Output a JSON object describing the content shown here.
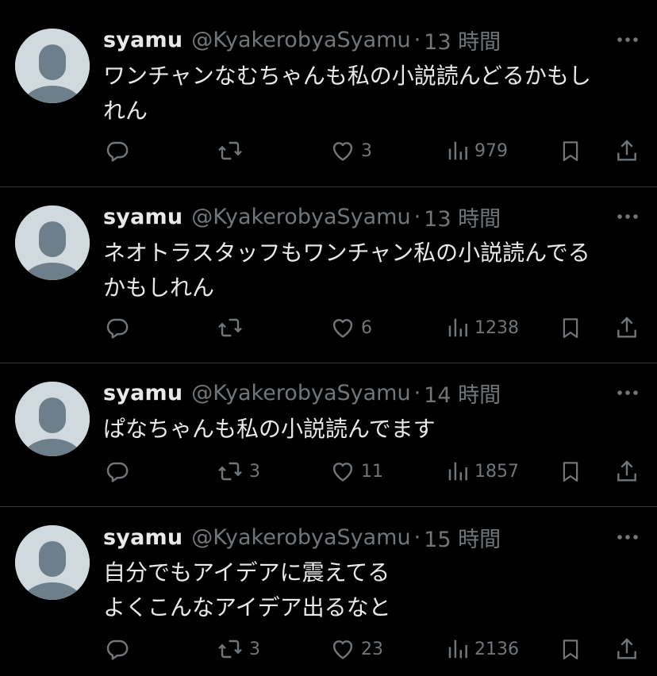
{
  "tweets": [
    {
      "name": "syamu",
      "handle": "@KyakerobyaSyamu",
      "separator": "·",
      "time": "13 時間",
      "text": "ワンチャンなむちゃんも私の小説読んどるかもし\nれん",
      "retweets": "",
      "likes": "3",
      "views": "979"
    },
    {
      "name": "syamu",
      "handle": "@KyakerobyaSyamu",
      "separator": "·",
      "time": "13 時間",
      "text": "ネオトラスタッフもワンチャン私の小説読んでる\nかもしれん",
      "retweets": "",
      "likes": "6",
      "views": "1238"
    },
    {
      "name": "syamu",
      "handle": "@KyakerobyaSyamu",
      "separator": "·",
      "time": "14 時間",
      "text": "ぱなちゃんも私の小説読んでます",
      "retweets": "3",
      "likes": "11",
      "views": "1857"
    },
    {
      "name": "syamu",
      "handle": "@KyakerobyaSyamu",
      "separator": "·",
      "time": "15 時間",
      "text": "自分でもアイデアに震えてる\nよくこんなアイデア出るなと",
      "retweets": "3",
      "likes": "23",
      "views": "2136"
    }
  ],
  "icons": {
    "reply": "reply-icon",
    "retweet": "retweet-icon",
    "like": "heart-icon",
    "views": "views-icon",
    "bookmark": "bookmark-icon",
    "share": "share-icon",
    "more": "more-icon"
  },
  "colors": {
    "background": "#000000",
    "text": "#e7e9ea",
    "secondary": "#71767b",
    "divider": "#2f3336",
    "avatar_bg": "#cfd9de",
    "avatar_fg": "#6e7f8c"
  }
}
